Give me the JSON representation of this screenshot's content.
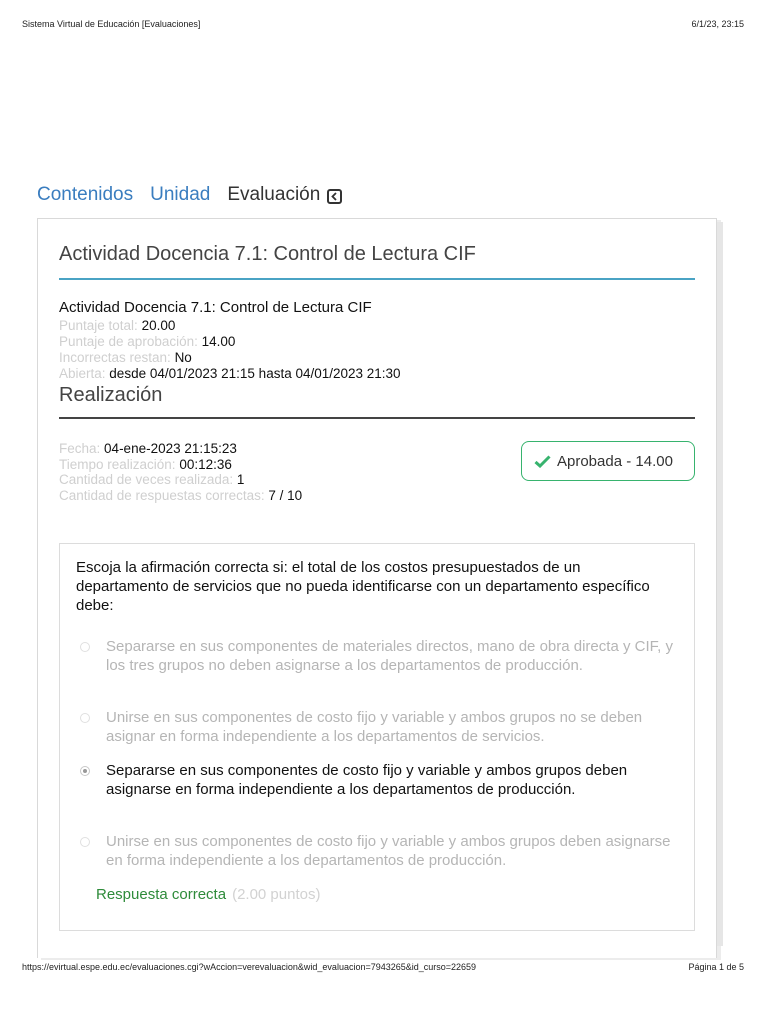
{
  "print": {
    "header_left": "Sistema Virtual de Educación [Evaluaciones]",
    "header_right": "6/1/23, 23:15",
    "footer_left": "https://evirtual.espe.edu.ec/evaluaciones.cgi?wAccion=verevaluacion&wid_evaluacion=7943265&id_curso=22659",
    "footer_right": "Página 1 de 5"
  },
  "nav": {
    "contenidos": "Contenidos",
    "unidad": "Unidad",
    "evaluacion": "Evaluación"
  },
  "activity": {
    "title": "Actividad Docencia 7.1: Control de Lectura CIF",
    "subtitle": "Actividad Docencia 7.1: Control de Lectura CIF",
    "puntaje_total_label": "Puntaje total:",
    "puntaje_total": "20.00",
    "puntaje_aprobacion_label": "Puntaje de aprobación:",
    "puntaje_aprobacion": "14.00",
    "incorrectas_label": "Incorrectas restan:",
    "incorrectas": "No",
    "abierta_label": "Abierta:",
    "abierta": "desde 04/01/2023 21:15 hasta 04/01/2023 21:30"
  },
  "realizacion": {
    "heading": "Realización",
    "fecha_label": "Fecha:",
    "fecha": "04-ene-2023 21:15:23",
    "tiempo_label": "Tiempo realización:",
    "tiempo": "00:12:36",
    "veces_label": "Cantidad de veces realizada:",
    "veces": "1",
    "correctas_label": "Cantidad de respuestas correctas:",
    "correctas": "7 / 10",
    "badge": "Aprobada - 14.00",
    "badge_color": "#37b36e"
  },
  "question": {
    "text": "Escoja la afirmación correcta si: el total de los costos presupuestados de un departamento de servicios que no pueda identificarse con un departamento específico debe:",
    "options": [
      {
        "text": "Separarse en sus componentes de materiales directos, mano de obra directa y CIF, y los tres grupos no deben asignarse a los departamentos de producción.",
        "selected": false
      },
      {
        "text": "Unirse en sus componentes de costo fijo y variable y ambos grupos no se deben asignar en forma independiente a los departamentos de servicios.",
        "selected": false
      },
      {
        "text": "Separarse en sus componentes de costo fijo y variable y ambos grupos deben asignarse en forma independiente a los departamentos de producción.",
        "selected": true
      },
      {
        "text": "Unirse en sus componentes de costo fijo y variable y ambos grupos deben asignarse en forma independiente a los departamentos de producción.",
        "selected": false
      }
    ],
    "result": "Respuesta correcta",
    "points": "(2.00 puntos)",
    "result_color": "#2e8b3a"
  }
}
